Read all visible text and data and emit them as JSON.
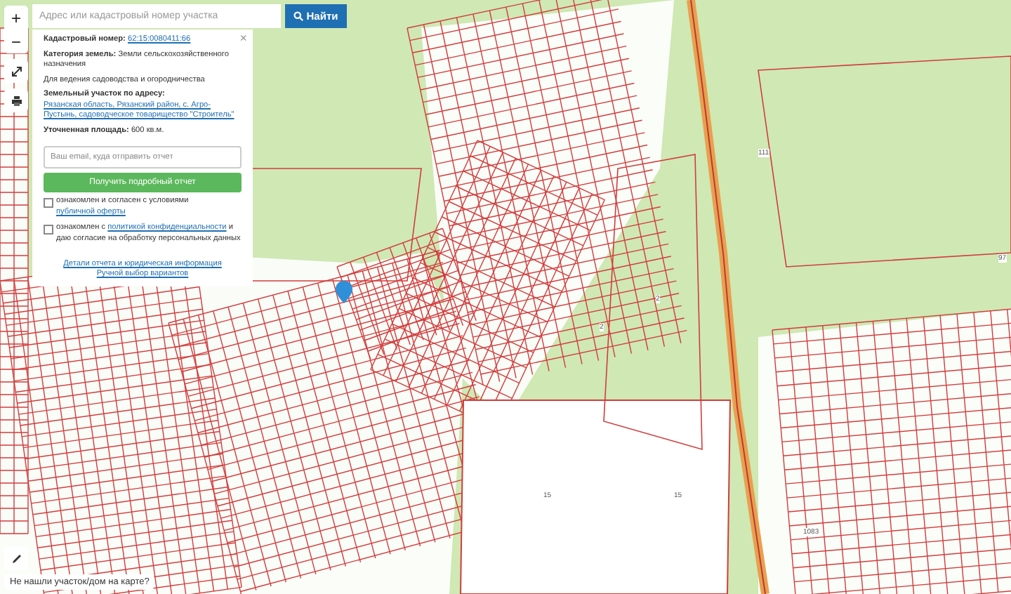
{
  "search": {
    "placeholder": "Адрес или кадастровый номер участка",
    "button": "Найти"
  },
  "map_controls": {
    "zoom_in": "+",
    "zoom_out": "−"
  },
  "parcel_panel": {
    "close": "×",
    "fields": [
      {
        "kind": "link",
        "label": "Кадастровый номер:",
        "value": "62:15:0080411:66"
      },
      {
        "kind": "text",
        "label": "Категория земель:",
        "value": "Земли сельскохозяйственного назначения"
      },
      {
        "kind": "plain",
        "value": "Для ведения садоводства и огородничества"
      },
      {
        "kind": "address",
        "label": "Земельный участок по адресу:",
        "value": "Рязанская область, Рязанский район, с. Агро-Пустынь, садоводческое товарищество \"Строитель\""
      },
      {
        "kind": "text",
        "label": "Уточненная площадь:",
        "value": "600 кв.м."
      }
    ],
    "email": {
      "placeholder": "Ваш email, куда отправить отчет"
    },
    "submit": "Получить подробный отчет",
    "consents": [
      {
        "checked": false,
        "text": "ознакомлен и согласен с условиями ",
        "link": "публичной оферты"
      },
      {
        "checked": false,
        "text": "ознакомлен с ",
        "link": "политикой конфиденциальности",
        "after": " и даю согласие на обработку персональных данных"
      }
    ],
    "links": [
      "Детали отчета и юридическая информация",
      "Ручной выбор вариантов"
    ]
  },
  "map_labels": [
    {
      "text": "111"
    },
    {
      "text": "15"
    },
    {
      "text": "15"
    },
    {
      "text": "2"
    },
    {
      "text": "2"
    },
    {
      "text": "97"
    },
    {
      "text": "1083"
    }
  ],
  "help": {
    "text": "Не нашли участок/дом на карте?"
  }
}
